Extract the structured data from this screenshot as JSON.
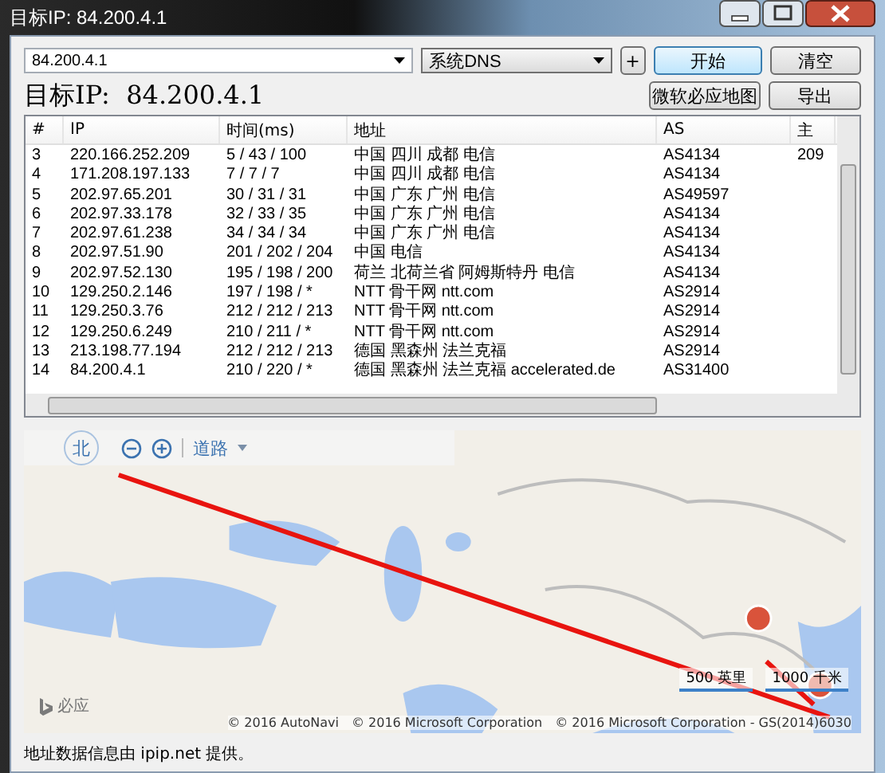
{
  "window": {
    "title": "目标IP: 84.200.4.1"
  },
  "target_input": {
    "value": "84.200.4.1"
  },
  "dns_select": {
    "value": "系统DNS"
  },
  "add_button": "+",
  "buttons_row1": [
    "开始",
    "清空"
  ],
  "target_label": "目标IP:  84.200.4.1",
  "buttons_row2": [
    "微软必应地图",
    "导出"
  ],
  "table": {
    "columns": [
      "#",
      "IP",
      "时间(ms)",
      "地址",
      "AS",
      "主"
    ],
    "rows": [
      [
        "3",
        "220.166.252.209",
        "5 / 43 / 100",
        "中国 四川 成都 电信",
        "AS4134",
        "209"
      ],
      [
        "4",
        "171.208.197.133",
        "7 / 7 / 7",
        "中国 四川 成都 电信",
        "AS4134",
        ""
      ],
      [
        "5",
        "202.97.65.201",
        "30 / 31 / 31",
        "中国 广东 广州 电信",
        "AS49597",
        ""
      ],
      [
        "6",
        "202.97.33.178",
        "32 / 33 / 35",
        "中国 广东 广州 电信",
        "AS4134",
        ""
      ],
      [
        "7",
        "202.97.61.238",
        "34 / 34 / 34",
        "中国 广东 广州 电信",
        "AS4134",
        ""
      ],
      [
        "8",
        "202.97.51.90",
        "201 / 202 / 204",
        "中国 电信",
        "AS4134",
        ""
      ],
      [
        "9",
        "202.97.52.130",
        "195 / 198 / 200",
        "荷兰 北荷兰省 阿姆斯特丹 电信",
        "AS4134",
        ""
      ],
      [
        "10",
        "129.250.2.146",
        "197 / 198 / *",
        "NTT 骨干网 ntt.com",
        "AS2914",
        ""
      ],
      [
        "11",
        "129.250.3.76",
        "212 / 212 / 213",
        "NTT 骨干网 ntt.com",
        "AS2914",
        ""
      ],
      [
        "12",
        "129.250.6.249",
        "210 / 211 / *",
        "NTT 骨干网 ntt.com",
        "AS2914",
        ""
      ],
      [
        "13",
        "213.198.77.194",
        "212 / 212 / 213",
        "德国 黑森州 法兰克福",
        "AS2914",
        ""
      ],
      [
        "14",
        "84.200.4.1",
        "210 / 220 / *",
        "德国 黑森州 法兰克福 accelerated.de",
        "AS31400",
        ""
      ]
    ]
  },
  "map": {
    "compass": "北",
    "road_menu": "道路",
    "scale": [
      "500 英里",
      "1000 千米"
    ],
    "brand": "必应",
    "copyright": [
      "© 2016 AutoNavi",
      "© 2016 Microsoft Corporation",
      "© 2016 Microsoft Corporation - GS(2014)6030"
    ]
  },
  "footer": "地址数据信息由 ipip.net 提供。"
}
